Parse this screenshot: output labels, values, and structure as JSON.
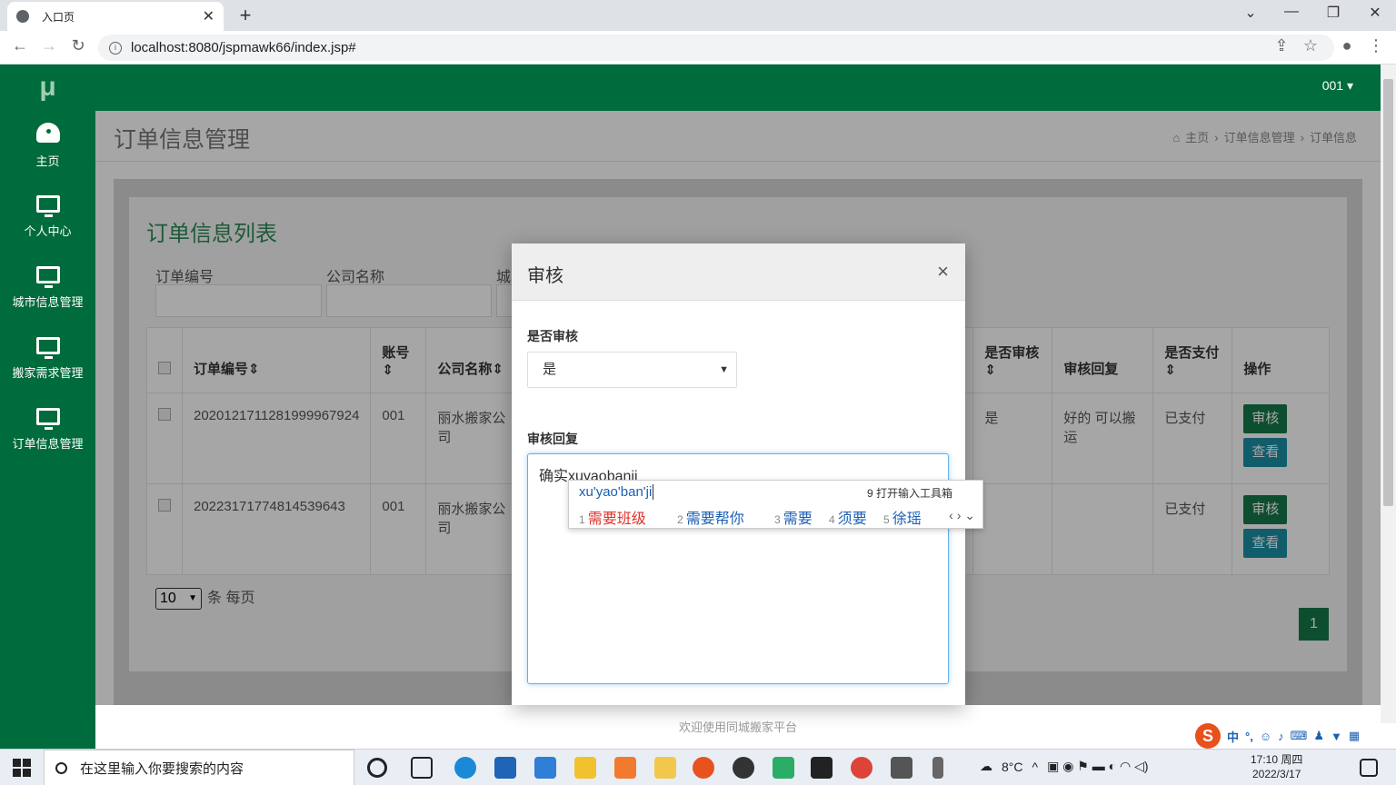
{
  "browser": {
    "tab_title": "入口页",
    "url": "localhost:8080/jspmawk66/index.jsp#"
  },
  "app": {
    "logo": "μ",
    "user": "001 ▾",
    "page_title": "订单信息管理",
    "breadcrumb": [
      "主页",
      "订单信息管理",
      "订单信息"
    ],
    "sidebar": [
      {
        "label": "主页",
        "icon": "dashboard-icon"
      },
      {
        "label": "个人中心",
        "icon": "monitor-icon"
      },
      {
        "label": "城市信息管理",
        "icon": "monitor-icon"
      },
      {
        "label": "搬家需求管理",
        "icon": "monitor-icon"
      },
      {
        "label": "订单信息管理",
        "icon": "monitor-icon"
      }
    ],
    "footer": "欢迎使用同城搬家平台"
  },
  "list": {
    "title": "订单信息列表",
    "filters": [
      "订单编号",
      "公司名称",
      "城"
    ],
    "headers": [
      "订单编号⇕",
      "账号⇕",
      "公司名称⇕",
      "是否审核⇕",
      "审核回复",
      "是否支付⇕",
      "操作"
    ],
    "rows": [
      {
        "order": "20201217112819999679 24",
        "order_text": "2020121711281999967924",
        "account": "001",
        "company": "丽水搬家公司",
        "audited": "是",
        "reply": "好的 可以搬运",
        "paid": "已支付"
      },
      {
        "order_text": "20223171774814539643",
        "account": "001",
        "company": "丽水搬家公司",
        "audited": "",
        "reply": "",
        "paid": "已支付"
      }
    ],
    "btn_audit": "审核",
    "btn_view": "查看",
    "page_size": "10",
    "page_size_suffix": "条 每页",
    "page": "1"
  },
  "modal": {
    "title": "审核",
    "close": "×",
    "field1_label": "是否审核",
    "field1_value": "是",
    "field2_label": "审核回复",
    "field2_value": "确实xuyaobanji"
  },
  "ime": {
    "pinyin": "xu'yao'ban'ji",
    "tool": "9 打开输入工具箱",
    "candidates": [
      {
        "n": "1",
        "t": "需要班级"
      },
      {
        "n": "2",
        "t": "需要帮你"
      },
      {
        "n": "3",
        "t": "需要"
      },
      {
        "n": "4",
        "t": "须要"
      },
      {
        "n": "5",
        "t": "徐瑶"
      }
    ]
  },
  "sogou": {
    "logo": "S",
    "lang": "中"
  },
  "taskbar": {
    "search": "在这里输入你要搜索的内容",
    "weather": "8°C",
    "time": "17:10 周四",
    "date": "2022/3/17"
  }
}
